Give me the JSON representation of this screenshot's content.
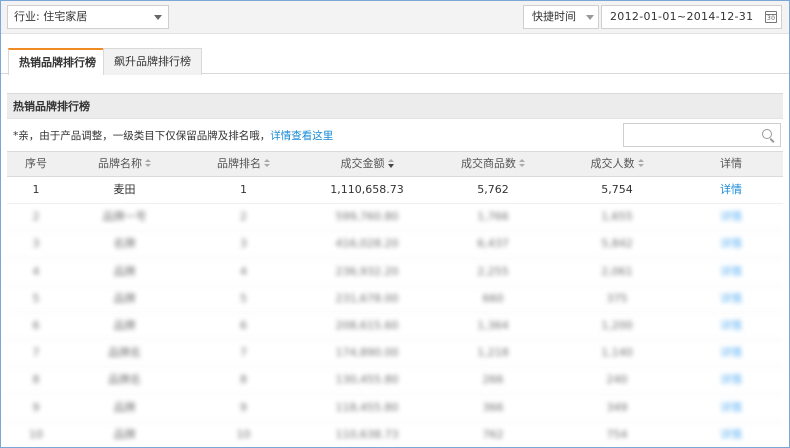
{
  "toolbar": {
    "industry_label": "行业: 住宅家居",
    "quick_time_label": "快捷时间",
    "date_range": "2012-01-01~2014-12-31"
  },
  "tabs": [
    {
      "label": "热销品牌排行榜",
      "active": true
    },
    {
      "label": "飙升品牌排行榜",
      "active": false
    }
  ],
  "panel": {
    "title": "热销品牌排行榜",
    "notice_text": "*亲，由于产品调整，一级类目下仅保留品牌及排名哦，",
    "notice_link": "详情查看这里",
    "search_placeholder": ""
  },
  "table": {
    "columns": [
      "序号",
      "品牌名称",
      "品牌排名",
      "成交金额",
      "成交商品数",
      "成交人数",
      "详情"
    ],
    "rows": [
      {
        "idx": "1",
        "brand": "麦田",
        "rank": "1",
        "amount": "1,110,658.73",
        "items": "5,762",
        "buyers": "5,754",
        "detail": "详情"
      },
      {
        "idx": "2",
        "brand": "品牌一号",
        "rank": "2",
        "amount": "599,760.80",
        "items": "1,766",
        "buyers": "1,655",
        "detail": "详情"
      },
      {
        "idx": "3",
        "brand": "名牌",
        "rank": "3",
        "amount": "416,028.20",
        "items": "6,437",
        "buyers": "5,842",
        "detail": "详情"
      },
      {
        "idx": "4",
        "brand": "品牌",
        "rank": "4",
        "amount": "236,932.20",
        "items": "2,255",
        "buyers": "2,061",
        "detail": "详情"
      },
      {
        "idx": "5",
        "brand": "品牌",
        "rank": "5",
        "amount": "231,678.00",
        "items": "660",
        "buyers": "375",
        "detail": "详情"
      },
      {
        "idx": "6",
        "brand": "品牌",
        "rank": "6",
        "amount": "208,615.60",
        "items": "1,364",
        "buyers": "1,200",
        "detail": "详情"
      },
      {
        "idx": "7",
        "brand": "品牌名",
        "rank": "7",
        "amount": "174,890.00",
        "items": "1,218",
        "buyers": "1,140",
        "detail": "详情"
      },
      {
        "idx": "8",
        "brand": "品牌名",
        "rank": "8",
        "amount": "130,455.80",
        "items": "266",
        "buyers": "240",
        "detail": "详情"
      },
      {
        "idx": "9",
        "brand": "品牌",
        "rank": "9",
        "amount": "118,455.80",
        "items": "366",
        "buyers": "349",
        "detail": "详情"
      },
      {
        "idx": "10",
        "brand": "品牌",
        "rank": "10",
        "amount": "110,638.73",
        "items": "762",
        "buyers": "754",
        "detail": "详情"
      }
    ]
  }
}
